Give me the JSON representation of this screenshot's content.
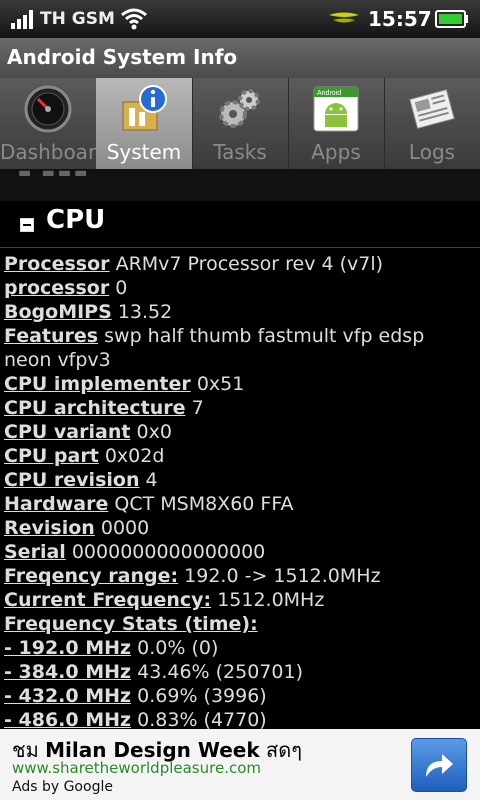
{
  "status_bar": {
    "carrier": "TH GSM",
    "time": "15:57",
    "signal_icon": "signal-bars-icon",
    "wifi_icon": "wifi-icon",
    "operator_icon": "operator-logo-icon",
    "battery_icon": "battery-icon",
    "battery_color": "#33cc33"
  },
  "app": {
    "title": "Android System Info"
  },
  "tabs": [
    {
      "label": "Dashboard",
      "icon": "gauge-icon",
      "selected": false
    },
    {
      "label": "System",
      "icon": "system-info-icon",
      "selected": true
    },
    {
      "label": "Tasks",
      "icon": "gears-icon",
      "selected": false
    },
    {
      "label": "Apps",
      "icon": "android-apps-icon",
      "selected": false
    },
    {
      "label": "Logs",
      "icon": "newspaper-icon",
      "selected": false
    }
  ],
  "section": {
    "title": "CPU",
    "icon": "collapse-icon"
  },
  "cpu_rows": [
    {
      "key": "Processor",
      "value": "ARMv7 Processor rev 4 (v7l)"
    },
    {
      "key": "processor",
      "value": "0"
    },
    {
      "key": "BogoMIPS",
      "value": "13.52"
    },
    {
      "key": "Features",
      "value": "swp half thumb fastmult vfp edsp neon vfpv3"
    },
    {
      "key": "CPU implementer",
      "value": "0x51"
    },
    {
      "key": "CPU architecture",
      "value": "7"
    },
    {
      "key": "CPU variant",
      "value": "0x0"
    },
    {
      "key": "CPU part",
      "value": "0x02d"
    },
    {
      "key": "CPU revision",
      "value": "4"
    },
    {
      "key": "Hardware",
      "value": "QCT MSM8X60 FFA"
    },
    {
      "key": "Revision",
      "value": "0000"
    },
    {
      "key": "Serial",
      "value": "0000000000000000"
    },
    {
      "key": "Freqency range:",
      "value": "192.0 -> 1512.0MHz"
    },
    {
      "key": "Current Frequency:",
      "value": "1512.0MHz"
    },
    {
      "key": "Frequency Stats (time):",
      "value": ""
    }
  ],
  "freq_stats": [
    {
      "freq": "- 192.0 MHz",
      "value": "0.0% (0)"
    },
    {
      "freq": "- 384.0 MHz",
      "value": "43.46% (250701)"
    },
    {
      "freq": "- 432.0 MHz",
      "value": "0.69% (3996)"
    },
    {
      "freq": "- 486.0 MHz",
      "value": "0.83% (4770)"
    }
  ],
  "ad": {
    "title_prefix": "ชม",
    "title_main": "Milan Design Week",
    "title_suffix": "สดๆ",
    "url": "www.sharetheworldpleasure.com",
    "by": "Ads by Google",
    "button_icon": "share-arrow-icon"
  }
}
